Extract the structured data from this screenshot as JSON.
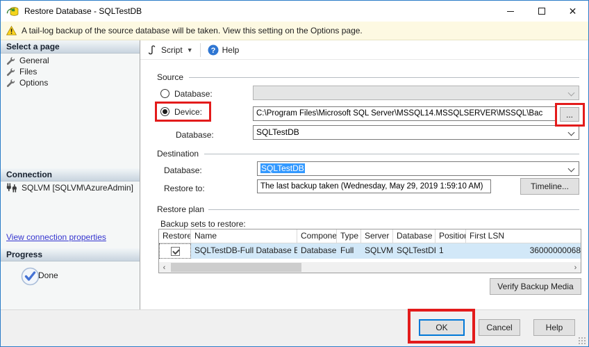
{
  "window": {
    "title": "Restore Database - SQLTestDB"
  },
  "banner": {
    "text": "A tail-log backup of the source database will be taken. View this setting on the Options page."
  },
  "sidebar": {
    "select_a_page": "Select a page",
    "pages": [
      {
        "label": "General"
      },
      {
        "label": "Files"
      },
      {
        "label": "Options"
      }
    ],
    "connection_header": "Connection",
    "connection_value": "SQLVM [SQLVM\\AzureAdmin]",
    "view_link": "View connection properties",
    "progress_header": "Progress",
    "progress_status": "Done"
  },
  "toolbar": {
    "script_label": "Script",
    "help_label": "Help"
  },
  "source": {
    "title": "Source",
    "database_label": "Database:",
    "device_label": "Device:",
    "device_path": "C:\\Program Files\\Microsoft SQL Server\\MSSQL14.MSSQLSERVER\\MSSQL\\Bac",
    "browse_label": "...",
    "database2_label": "Database:",
    "database_value": "SQLTestDB"
  },
  "destination": {
    "title": "Destination",
    "database_label": "Database:",
    "database_value": "SQLTestDB",
    "restore_to_label": "Restore to:",
    "restore_to_value": "The last backup taken (Wednesday, May 29, 2019 1:59:10 AM)",
    "timeline_label": "Timeline..."
  },
  "restore_plan": {
    "title": "Restore plan",
    "backup_sets_label": "Backup sets to restore:",
    "columns": [
      "Restore",
      "Name",
      "Component",
      "Type",
      "Server",
      "Database",
      "Position",
      "First LSN"
    ],
    "rows": [
      {
        "restore_checked": true,
        "name": "SQLTestDB-Full Database Backup",
        "component": "Database",
        "type": "Full",
        "server": "SQLVM",
        "database": "SQLTestDB",
        "position": "1",
        "first_lsn": "36000000068"
      }
    ],
    "verify_label": "Verify Backup Media"
  },
  "footer": {
    "ok_label": "OK",
    "cancel_label": "Cancel",
    "help_label": "Help"
  },
  "colors": {
    "annotation_red": "#e31b1b",
    "selection_blue": "#3399ff",
    "focus_blue": "#0078d7",
    "banner_bg": "#fdf9e2"
  }
}
